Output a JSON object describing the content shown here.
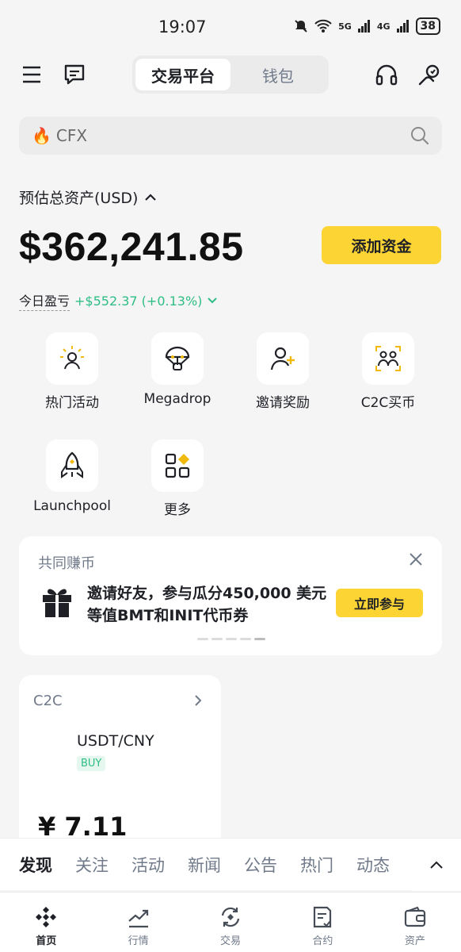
{
  "status_bar": {
    "time": "19:07",
    "network1": "5G",
    "network2": "4G",
    "battery": "38"
  },
  "topnav": {
    "tabs": [
      {
        "label": "交易平台",
        "active": true
      },
      {
        "label": "钱包",
        "active": false
      }
    ]
  },
  "search": {
    "icon": "fire-icon",
    "value": "CFX"
  },
  "assets": {
    "label": "预估总资产(USD)",
    "balance": "$362,241.85",
    "add_funds_label": "添加资金",
    "pnl_label": "今日盈亏",
    "pnl_value": "+$552.37 (+0.13%)"
  },
  "shortcuts": [
    {
      "label": "热门活动",
      "icon": "hot-activity-icon"
    },
    {
      "label": "Megadrop",
      "icon": "megadrop-icon"
    },
    {
      "label": "邀请奖励",
      "icon": "invite-reward-icon"
    },
    {
      "label": "C2C买币",
      "icon": "c2c-buy-icon"
    },
    {
      "label": "Launchpool",
      "icon": "launchpool-rocket-icon"
    },
    {
      "label": "更多",
      "icon": "more-grid-icon"
    }
  ],
  "promo": {
    "title": "共同赚币",
    "text": "邀请好友，参与瓜分450,000 美元等值BMT和INIT代币券",
    "button": "立即参与"
  },
  "c2c": {
    "title": "C2C",
    "pair": "USDT/CNY",
    "side": "BUY",
    "price": "¥ 7.11"
  },
  "feed_tabs": [
    "发现",
    "关注",
    "活动",
    "新闻",
    "公告",
    "热门",
    "动态"
  ],
  "bottom_nav": [
    {
      "label": "首页",
      "icon": "home-icon",
      "active": true
    },
    {
      "label": "行情",
      "icon": "markets-icon",
      "active": false
    },
    {
      "label": "交易",
      "icon": "trade-icon",
      "active": false
    },
    {
      "label": "合约",
      "icon": "futures-icon",
      "active": false
    },
    {
      "label": "资产",
      "icon": "wallet-icon",
      "active": false
    }
  ],
  "colors": {
    "accent": "#fcd535",
    "positive": "#2ebd85",
    "text": "#1e2026",
    "muted": "#707a8a"
  }
}
